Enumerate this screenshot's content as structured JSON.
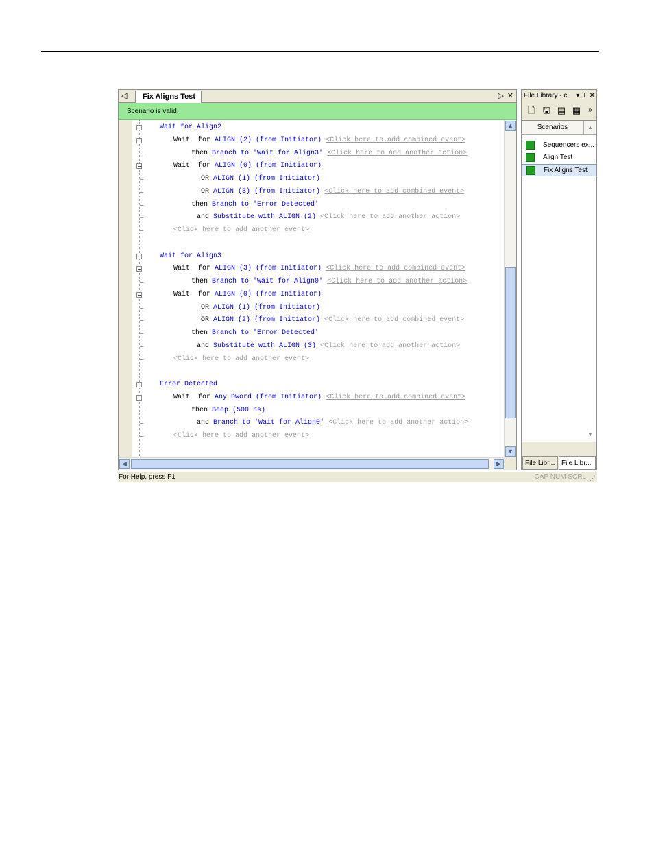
{
  "editor": {
    "tab_title": "Fix Aligns Test",
    "tab_prev_glyph": "◁",
    "tab_next_glyph": "▷",
    "tab_close_glyph": "✕",
    "status_message": "Scenario is valid."
  },
  "code_lines": [
    {
      "type": "heading",
      "text": "Wait for Align2",
      "toggle": true
    },
    {
      "type": "event",
      "parts": [
        [
          "kw",
          "Wait  for "
        ],
        [
          "blu",
          "ALIGN (2) (from Initiator)"
        ],
        [
          "hint",
          "<Click here to add combined event>"
        ]
      ],
      "indent": 58,
      "toggle": true
    },
    {
      "type": "action",
      "parts": [
        [
          "kw",
          "then "
        ],
        [
          "blu",
          "Branch to 'Wait for Align3'"
        ],
        [
          "hint",
          "<Click here to add another action>"
        ]
      ],
      "indent": 84
    },
    {
      "type": "event",
      "parts": [
        [
          "kw",
          "Wait  for "
        ],
        [
          "blu",
          "ALIGN (0) (from Initiator)"
        ]
      ],
      "indent": 58,
      "toggle": true
    },
    {
      "type": "event",
      "parts": [
        [
          "kw",
          "OR "
        ],
        [
          "blu",
          "ALIGN (1) (from Initiator)"
        ]
      ],
      "indent": 98
    },
    {
      "type": "event",
      "parts": [
        [
          "kw",
          "OR "
        ],
        [
          "blu",
          "ALIGN (3) (from Initiator)"
        ],
        [
          "hint",
          "<Click here to add combined event>"
        ]
      ],
      "indent": 98
    },
    {
      "type": "action",
      "parts": [
        [
          "kw",
          "then "
        ],
        [
          "blu",
          "Branch to 'Error Detected'"
        ]
      ],
      "indent": 84
    },
    {
      "type": "action",
      "parts": [
        [
          "kw",
          "and "
        ],
        [
          "blu",
          "Substitute with ALIGN (2)"
        ],
        [
          "hint",
          "<Click here to add another action>"
        ]
      ],
      "indent": 92
    },
    {
      "type": "add",
      "parts": [
        [
          "hint",
          "<Click here to add another event>"
        ]
      ],
      "indent": 58
    },
    {
      "type": "blank"
    },
    {
      "type": "heading",
      "text": "Wait for Align3",
      "toggle": true
    },
    {
      "type": "event",
      "parts": [
        [
          "kw",
          "Wait  for "
        ],
        [
          "blu",
          "ALIGN (3) (from Initiator)"
        ],
        [
          "hint",
          "<Click here to add combined event>"
        ]
      ],
      "indent": 58,
      "toggle": true
    },
    {
      "type": "action",
      "parts": [
        [
          "kw",
          "then "
        ],
        [
          "blu",
          "Branch to 'Wait for Align0'"
        ],
        [
          "hint",
          "<Click here to add another action>"
        ]
      ],
      "indent": 84
    },
    {
      "type": "event",
      "parts": [
        [
          "kw",
          "Wait  for "
        ],
        [
          "blu",
          "ALIGN (0) (from Initiator)"
        ]
      ],
      "indent": 58,
      "toggle": true
    },
    {
      "type": "event",
      "parts": [
        [
          "kw",
          "OR "
        ],
        [
          "blu",
          "ALIGN (1) (from Initiator)"
        ]
      ],
      "indent": 98
    },
    {
      "type": "event",
      "parts": [
        [
          "kw",
          "OR "
        ],
        [
          "blu",
          "ALIGN (2) (from Initiator)"
        ],
        [
          "hint",
          "<Click here to add combined event>"
        ]
      ],
      "indent": 98
    },
    {
      "type": "action",
      "parts": [
        [
          "kw",
          "then "
        ],
        [
          "blu",
          "Branch to 'Error Detected'"
        ]
      ],
      "indent": 84
    },
    {
      "type": "action",
      "parts": [
        [
          "kw",
          "and "
        ],
        [
          "blu",
          "Substitute with ALIGN (3)"
        ],
        [
          "hint",
          "<Click here to add another action>"
        ]
      ],
      "indent": 92
    },
    {
      "type": "add",
      "parts": [
        [
          "hint",
          "<Click here to add another event>"
        ]
      ],
      "indent": 58
    },
    {
      "type": "blank"
    },
    {
      "type": "heading",
      "text": "Error Detected",
      "toggle": true
    },
    {
      "type": "event",
      "parts": [
        [
          "kw",
          "Wait  for "
        ],
        [
          "blu",
          "Any Dword (from Initiator)"
        ],
        [
          "hint",
          "<Click here to add combined event>"
        ]
      ],
      "indent": 58,
      "toggle": true
    },
    {
      "type": "action",
      "parts": [
        [
          "kw",
          "then "
        ],
        [
          "blu",
          "Beep (500 ns)"
        ]
      ],
      "indent": 84
    },
    {
      "type": "action",
      "parts": [
        [
          "kw",
          "and "
        ],
        [
          "blu",
          "Branch to 'Wait for Align0'"
        ],
        [
          "hint",
          "<Click here to add another action>"
        ]
      ],
      "indent": 92
    },
    {
      "type": "add",
      "parts": [
        [
          "hint",
          "<Click here to add another event>"
        ]
      ],
      "indent": 58
    }
  ],
  "library": {
    "title": "File Library - c",
    "tools_glyphs": "▾ ⊥ ✕",
    "toolbar_more": "»",
    "column_header": "Scenarios",
    "items": [
      "Sequencers ex...",
      "Align Test",
      "Fix Aligns Test"
    ],
    "selected_index": 2,
    "bottom_tabs": [
      "File Libr...",
      "File Libr..."
    ]
  },
  "statusbar": {
    "help_text": "For Help, press F1",
    "indicators": "CAP  NUM  SCRL"
  },
  "colors": {
    "valid_green": "#98e898",
    "keyword_blue": "#0000c8",
    "hint_gray": "#9a9a9a"
  }
}
